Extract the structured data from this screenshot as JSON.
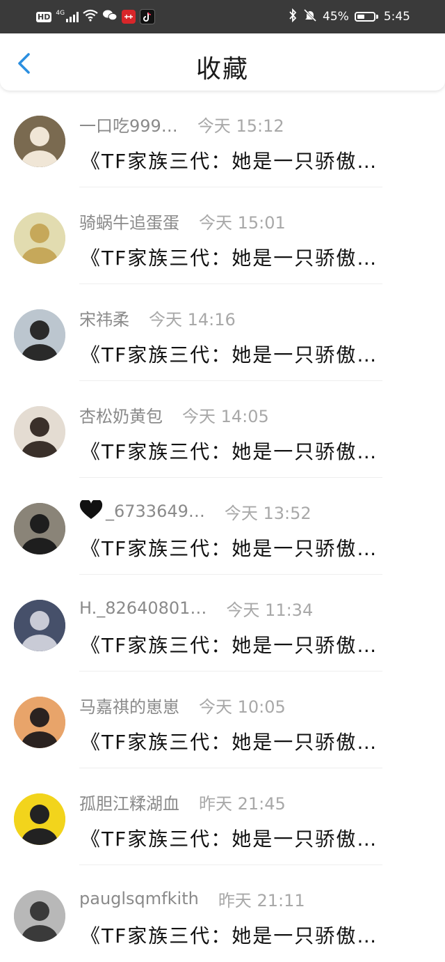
{
  "status_bar": {
    "hd": "HD",
    "signal_label": "4G",
    "battery_percent": "45%",
    "battery_level": 0.45,
    "time": "5:45"
  },
  "header": {
    "title": "收藏",
    "accent_color": "#2b8fe0"
  },
  "items": [
    {
      "name": "一口吃999…",
      "time": "今天 15:12",
      "work": "《TF家族三代：她是一只骄傲…",
      "avatar": {
        "icon": "avatar-plush-toy",
        "bg": "#7a6a50",
        "fg": "#f0e6d6"
      }
    },
    {
      "name": "骑蜗牛追蛋蛋",
      "time": "今天 15:01",
      "work": "《TF家族三代：她是一只骄傲…",
      "avatar": {
        "icon": "avatar-anime-girl",
        "bg": "#e2dcb0",
        "fg": "#c6a85a"
      }
    },
    {
      "name": "宋祎柔",
      "time": "今天 14:16",
      "work": "《TF家族三代：她是一只骄傲…",
      "avatar": {
        "icon": "avatar-boy-portrait",
        "bg": "#bcc6cf",
        "fg": "#2a2a2a"
      }
    },
    {
      "name": "杏松奶黄包",
      "time": "今天 14:05",
      "work": "《TF家族三代：她是一只骄傲…",
      "avatar": {
        "icon": "avatar-boy-white-shirt",
        "bg": "#e4dcd2",
        "fg": "#3a302a"
      }
    },
    {
      "name": "_6733649…",
      "time": "今天 13:52",
      "work": "《TF家族三代：她是一只骄傲…",
      "avatar": {
        "icon": "avatar-girl-dark",
        "bg": "#8a8478",
        "fg": "#1e1e1e"
      },
      "heart": true
    },
    {
      "name": "H._82640801…",
      "time": "今天 11:34",
      "work": "《TF家族三代：她是一只骄傲…",
      "avatar": {
        "icon": "avatar-girl-blue",
        "bg": "#46506a",
        "fg": "#c9cbd6"
      }
    },
    {
      "name": "马嘉祺的崽崽",
      "time": "今天 10:05",
      "work": "《TF家族三代：她是一只骄傲…",
      "avatar": {
        "icon": "avatar-boy-sunset",
        "bg": "#e8a46a",
        "fg": "#2a2220"
      }
    },
    {
      "name": "孤胆江糅湖血",
      "time": "昨天 21:45",
      "work": "《TF家族三代：她是一只骄傲…",
      "avatar": {
        "icon": "avatar-yellow-sketch",
        "bg": "#f2d41c",
        "fg": "#222222"
      }
    },
    {
      "name": "pauglsqmfkith",
      "time": "昨天 21:11",
      "work": "《TF家族三代：她是一只骄傲…",
      "avatar": {
        "icon": "avatar-gray-photo",
        "bg": "#b8b8b8",
        "fg": "#3a3a3a"
      }
    }
  ]
}
